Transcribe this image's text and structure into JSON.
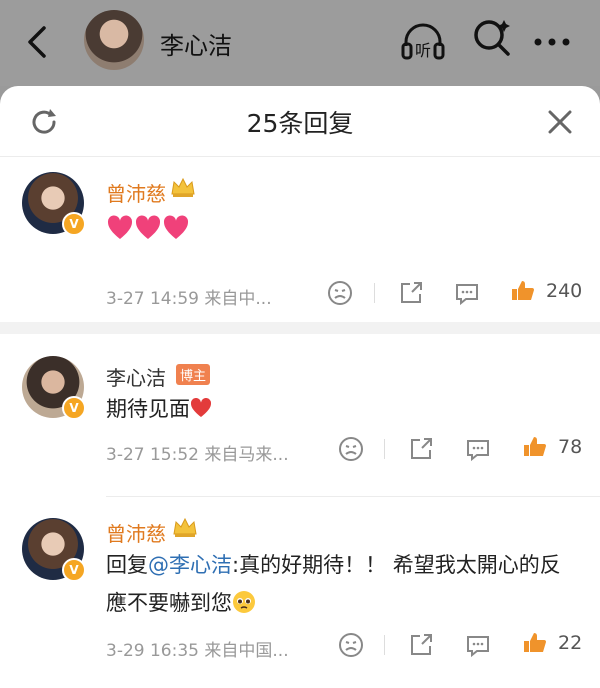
{
  "topbar": {
    "title": "李心洁",
    "listen_label": "听"
  },
  "sheet": {
    "title": "25条回复"
  },
  "comments": [
    {
      "name": "曾沛慈",
      "text": "",
      "time": "3-27 14:59",
      "source": "来自中...",
      "likes": "240"
    },
    {
      "name": "李心洁",
      "tag": "博主",
      "text": "期待见面",
      "time": "3-27 15:52",
      "source": "来自马来...",
      "likes": "78"
    },
    {
      "name": "曾沛慈",
      "reply_prefix": "回复",
      "mention": "@李心洁",
      "text": ":真的好期待！！ 希望我太開心的反應不要嚇到您",
      "time": "3-29 16:35",
      "source": "来自中国...",
      "likes": "22"
    }
  ],
  "colors": {
    "accent_orange": "#e07a1f",
    "mention_blue": "#2f6fb3",
    "like_orange": "#f0932b",
    "heart_pink": "#f0417a"
  }
}
